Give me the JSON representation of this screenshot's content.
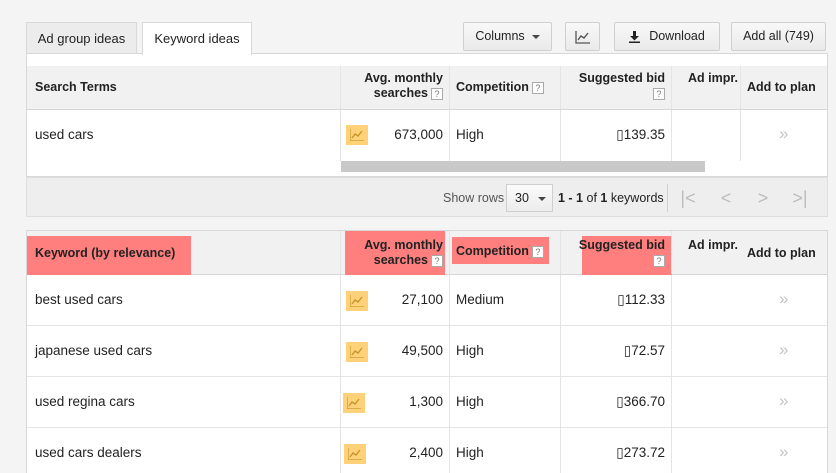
{
  "tabs": [
    {
      "label": "Ad group ideas"
    },
    {
      "label": "Keyword ideas"
    }
  ],
  "toolbar": {
    "columns_label": "Columns",
    "chart_icon": "line-chart-icon",
    "download_label": "Download",
    "add_all_label": "Add all (749)"
  },
  "search_terms_table": {
    "headers": {
      "term": "Search Terms",
      "avg_line1": "Avg. monthly",
      "avg_line2": "searches",
      "competition": "Competition",
      "bid": "Suggested bid",
      "impr": "Ad impr.",
      "add": "Add to plan"
    },
    "rows": [
      {
        "keyword": "used cars",
        "searches": "673,000",
        "competition": "High",
        "bid": "▯139.35",
        "add": "»"
      }
    ]
  },
  "pager": {
    "show_rows_label": "Show rows",
    "rows_value": "30",
    "range": "1 - 1",
    "of": "of",
    "total": "1",
    "unit": "keywords",
    "first_icon": "first-page-icon",
    "prev_icon": "prev-page-icon",
    "next_icon": "next-page-icon",
    "last_icon": "last-page-icon"
  },
  "keyword_table": {
    "headers": {
      "keyword": "Keyword (by relevance)",
      "avg_line1": "Avg. monthly",
      "avg_line2": "searches",
      "competition": "Competition",
      "bid": "Suggested bid",
      "impr": "Ad impr.",
      "add": "Add to plan"
    },
    "rows": [
      {
        "keyword": "best used cars",
        "searches": "27,100",
        "competition": "Medium",
        "bid": "▯112.33",
        "add": "»"
      },
      {
        "keyword": "japanese used cars",
        "searches": "49,500",
        "competition": "High",
        "bid": "▯72.57",
        "add": "»"
      },
      {
        "keyword": "used regina cars",
        "searches": "1,300",
        "competition": "High",
        "bid": "▯366.70",
        "add": "»"
      },
      {
        "keyword": "used cars dealers",
        "searches": "2,400",
        "competition": "High",
        "bid": "▯273.72",
        "add": "»"
      }
    ]
  },
  "colors": {
    "highlight": "#ff7f7f",
    "trend_icon_bg": "#ffd27a"
  }
}
